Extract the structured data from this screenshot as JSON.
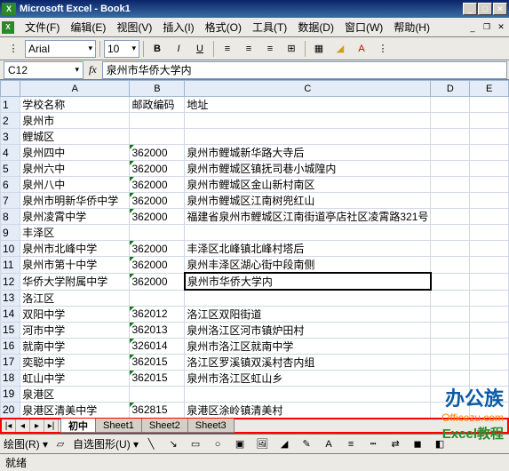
{
  "titlebar": {
    "title": "Microsoft Excel - Book1"
  },
  "menu": {
    "file": "文件(F)",
    "edit": "编辑(E)",
    "view": "视图(V)",
    "insert": "插入(I)",
    "format": "格式(O)",
    "tools": "工具(T)",
    "data": "数据(D)",
    "window": "窗口(W)",
    "help": "帮助(H)"
  },
  "font": {
    "name": "Arial",
    "size": "10"
  },
  "cellref": {
    "name": "C12",
    "value": "泉州市华侨大学内"
  },
  "columns": [
    "A",
    "B",
    "C",
    "D",
    "E"
  ],
  "rows": [
    {
      "n": "1",
      "A": "学校名称",
      "B": "邮政编码",
      "C": "地址"
    },
    {
      "n": "2",
      "A": "泉州市"
    },
    {
      "n": "3",
      "A": "鲤城区"
    },
    {
      "n": "4",
      "A": "泉州四中",
      "B": "362000",
      "C": "泉州市鲤城新华路大寺后",
      "g": true
    },
    {
      "n": "5",
      "A": "泉州六中",
      "B": "362000",
      "C": "泉州市鲤城区镇抚司巷小城隍内",
      "g": true
    },
    {
      "n": "6",
      "A": "泉州八中",
      "B": "362000",
      "C": "泉州市鲤城区金山新村南区",
      "g": true
    },
    {
      "n": "7",
      "A": "泉州市明新华侨中学",
      "B": "362000",
      "C": "泉州市鲤城区江南树兜红山",
      "g": true
    },
    {
      "n": "8",
      "A": "泉州凌霄中学",
      "B": "362000",
      "C": "福建省泉州市鲤城区江南街道亭店社区凌霄路321号",
      "g": true
    },
    {
      "n": "9",
      "A": "丰泽区"
    },
    {
      "n": "10",
      "A": "泉州市北峰中学",
      "B": "362000",
      "C": "丰泽区北峰镇北峰村塔后",
      "g": true
    },
    {
      "n": "11",
      "A": "泉州市第十中学",
      "B": "362000",
      "C": "泉州丰泽区湖心街中段南侧",
      "g": true
    },
    {
      "n": "12",
      "A": "华侨大学附属中学",
      "B": "362000",
      "C": "泉州市华侨大学内",
      "g": true,
      "selC": true
    },
    {
      "n": "13",
      "A": "洛江区"
    },
    {
      "n": "14",
      "A": "双阳中学",
      "B": "362012",
      "C": "洛江区双阳街道",
      "g": true
    },
    {
      "n": "15",
      "A": "河市中学",
      "B": "362013",
      "C": "泉州洛江区河市镇炉田村",
      "g": true
    },
    {
      "n": "16",
      "A": "就南中学",
      "B": "326014",
      "C": "泉州市洛江区就南中学",
      "g": true
    },
    {
      "n": "17",
      "A": "奕聪中学",
      "B": "362015",
      "C": "洛江区罗溪镇双溪村杏内组",
      "g": true
    },
    {
      "n": "18",
      "A": "虹山中学",
      "B": "362015",
      "C": "泉州市洛江区虹山乡",
      "g": true
    },
    {
      "n": "19",
      "A": "泉港区"
    },
    {
      "n": "20",
      "A": "泉港区清美中学",
      "B": "362815",
      "C": "泉港区涂岭镇清美村",
      "g": true
    }
  ],
  "tabs": {
    "active": "初中",
    "others": [
      "Sheet1",
      "Sheet2",
      "Sheet3"
    ]
  },
  "drawbar": {
    "label": "绘图(R)",
    "autoshape": "自选图形(U)"
  },
  "status": "就绪",
  "watermark": {
    "l1": "办公族",
    "l2": "Officezu.com",
    "l3": "Excel教程"
  }
}
